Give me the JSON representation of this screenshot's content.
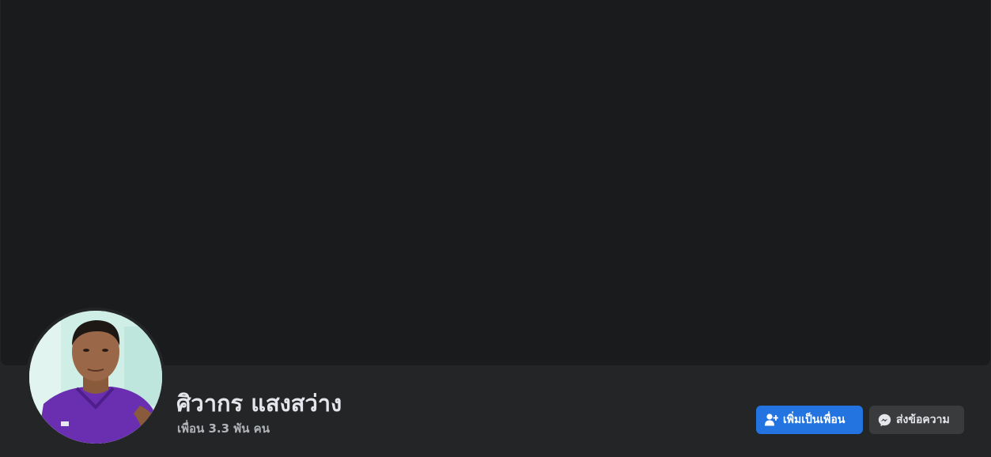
{
  "profile": {
    "name": "ศิวากร แสงสว่าง",
    "friends": "เพื่อน 3.3 พัน คน"
  },
  "actions": {
    "add_friend_label": "เพิ่มเป็นเพื่อน",
    "add_friend_icon": "add-friend-icon",
    "message_label": "ส่งข้อความ",
    "message_icon": "messenger-icon"
  },
  "colors": {
    "cover": "#1a1b1d",
    "background": "#242526",
    "primary_button": "#2374e1",
    "secondary_button": "#3a3b3c"
  }
}
